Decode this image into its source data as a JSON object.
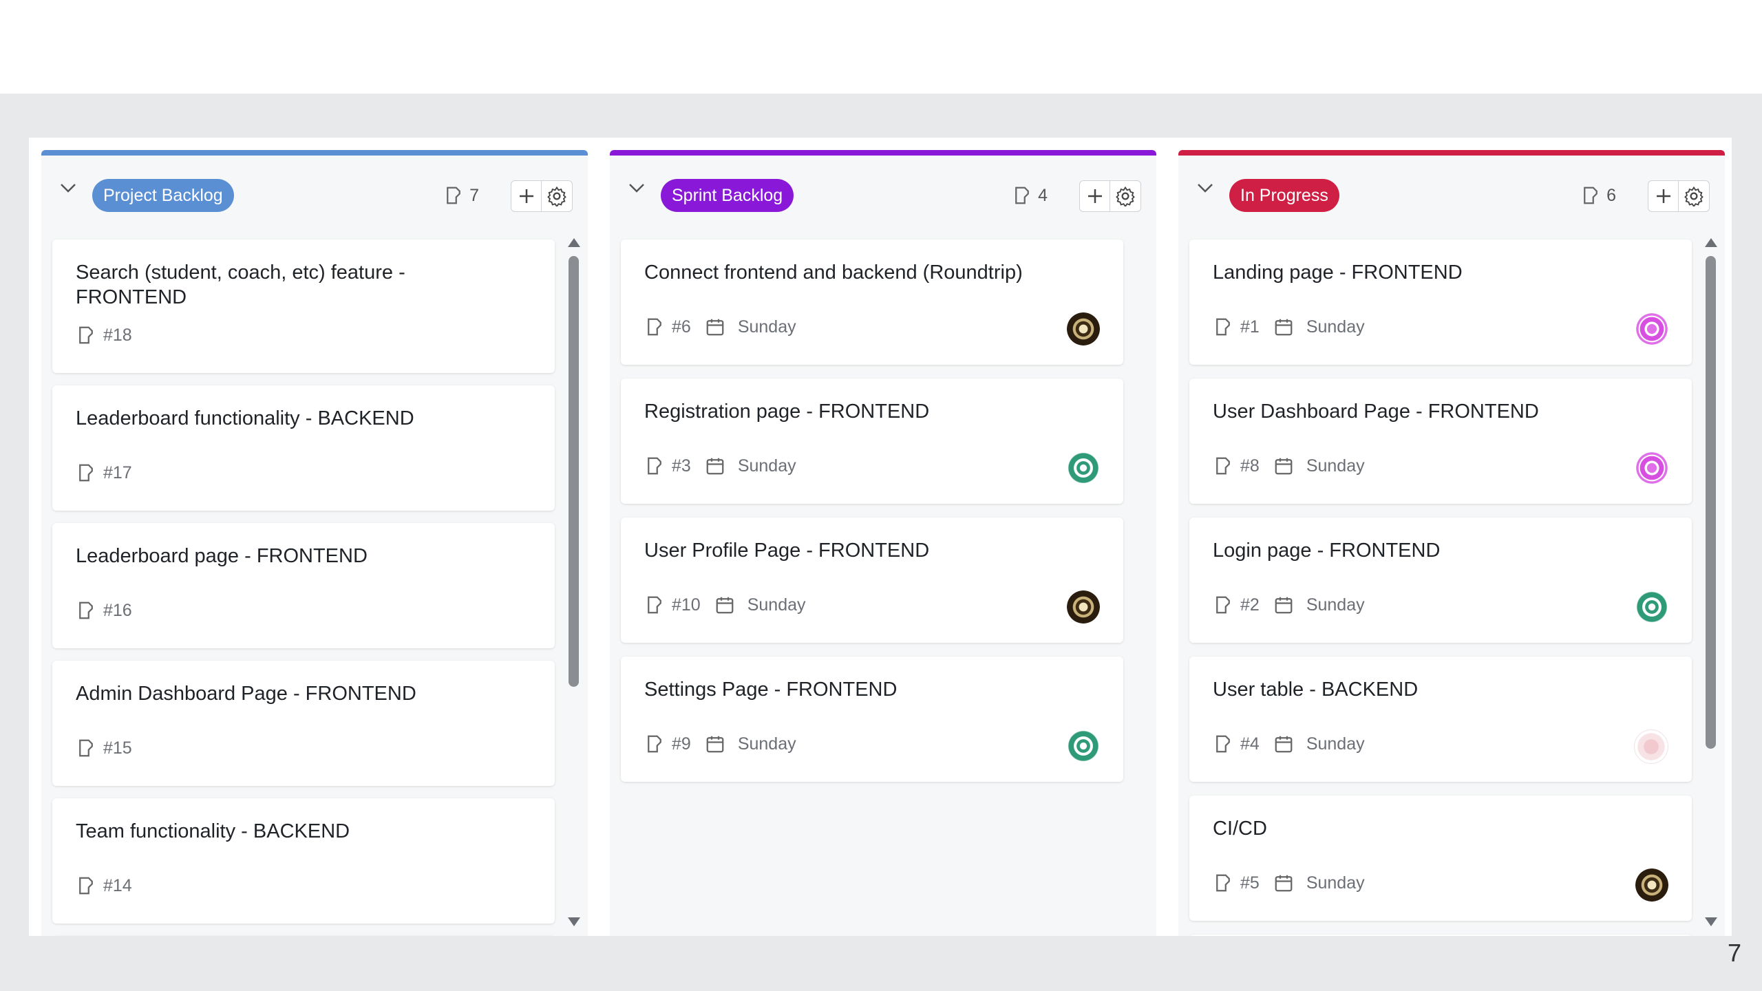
{
  "page_number": "7",
  "columns": [
    {
      "name": "Project Backlog",
      "color": "#5b8fd4",
      "count": "7",
      "cards": [
        {
          "title": "Search (student, coach, etc) feature - FRONTEND",
          "number": "#18"
        },
        {
          "title": "Leaderboard functionality - BACKEND",
          "number": "#17"
        },
        {
          "title": "Leaderboard page - FRONTEND",
          "number": "#16"
        },
        {
          "title": "Admin Dashboard Page - FRONTEND",
          "number": "#15"
        },
        {
          "title": "Team functionality - BACKEND",
          "number": "#14"
        }
      ]
    },
    {
      "name": "Sprint Backlog",
      "color": "#8a18d8",
      "count": "4",
      "cards": [
        {
          "title": "Connect frontend and backend (Roundtrip)",
          "number": "#6",
          "date": "Sunday",
          "avatar": "avatar-dark"
        },
        {
          "title": "Registration page - FRONTEND",
          "number": "#3",
          "date": "Sunday",
          "avatar": "avatar-green"
        },
        {
          "title": "User Profile Page - FRONTEND",
          "number": "#10",
          "date": "Sunday",
          "avatar": "avatar-dark"
        },
        {
          "title": "Settings Page - FRONTEND",
          "number": "#9",
          "date": "Sunday",
          "avatar": "avatar-green"
        }
      ]
    },
    {
      "name": "In Progress",
      "color": "#cf1f45",
      "count": "6",
      "cards": [
        {
          "title": "Landing page - FRONTEND",
          "number": "#1",
          "date": "Sunday",
          "avatar": "avatar-pink"
        },
        {
          "title": "User Dashboard Page - FRONTEND",
          "number": "#8",
          "date": "Sunday",
          "avatar": "avatar-pink"
        },
        {
          "title": "Login page - FRONTEND",
          "number": "#2",
          "date": "Sunday",
          "avatar": "avatar-green"
        },
        {
          "title": "User table - BACKEND",
          "number": "#4",
          "date": "Sunday",
          "avatar": "avatar-faded"
        },
        {
          "title": "CI/CD",
          "number": "#5",
          "date": "Sunday",
          "avatar": "avatar-dark"
        }
      ]
    }
  ]
}
